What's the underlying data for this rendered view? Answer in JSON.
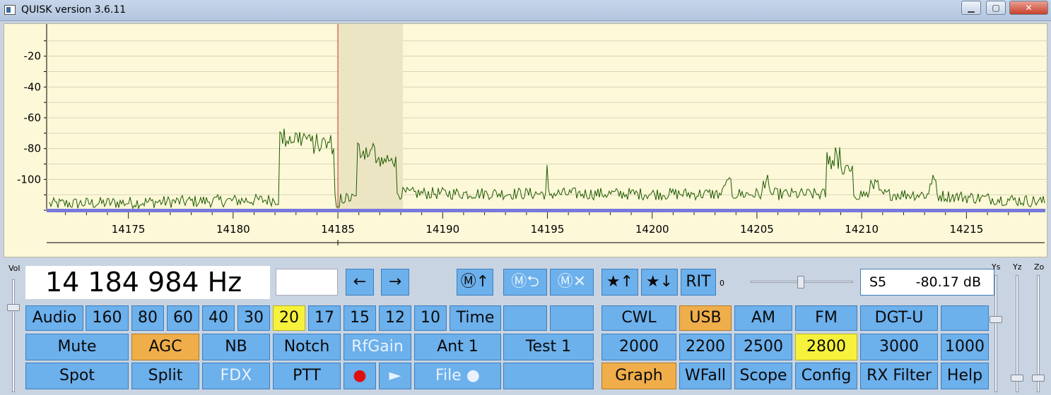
{
  "window": {
    "title": "QUISK version 3.6.11"
  },
  "graph": {
    "y_ticks": [
      "-20",
      "-40",
      "-60",
      "-80",
      "-100"
    ],
    "x_ticks": [
      "14175",
      "14180",
      "14185",
      "14190",
      "14195",
      "14200",
      "14205",
      "14210",
      "14215"
    ],
    "tuned_khz": 14185,
    "passband_khz": [
      14185,
      14188.1
    ],
    "x_range_khz": [
      14171.1,
      14218.9
    ],
    "y_range_db": [
      -120,
      0
    ],
    "colors": {
      "background": "#fcf8d8",
      "trace": "#1f5a00",
      "cursor": "#c83030",
      "baseline": "#7878dc",
      "passband": "#ece5c3"
    }
  },
  "freq": {
    "display": "14 184 984 Hz"
  },
  "nav": {
    "left": "←",
    "right": "→"
  },
  "memory": {
    "save": "Ⓜ↑",
    "swap": "Ⓜ⮌",
    "delete": "Ⓜ✕"
  },
  "favorites": {
    "up": "★↑",
    "down": "★↓"
  },
  "rit": {
    "label": "RIT",
    "value": "0"
  },
  "smeter": {
    "level": "S5",
    "db": "-80.17 dB"
  },
  "sliders": {
    "vol": "Vol",
    "ys": "Ys",
    "yz": "Yz",
    "zo": "Zo"
  },
  "row1": [
    "Audio",
    "160",
    "80",
    "60",
    "40",
    "30",
    "20",
    "17",
    "15",
    "12",
    "10",
    "Time",
    "",
    ""
  ],
  "row2": [
    "Mute",
    "AGC",
    "NB",
    "Notch",
    "RfGain",
    "Ant 1",
    "Test 1"
  ],
  "row3": [
    "Spot",
    "Split",
    "FDX",
    "PTT",
    "●",
    "►",
    "File ●",
    ""
  ],
  "modes": [
    "CWL",
    "USB",
    "AM",
    "FM",
    "DGT-U",
    ""
  ],
  "filters": [
    "2000",
    "2200",
    "2500",
    "2800",
    "3000",
    "1000"
  ],
  "bottom_right": [
    "Graph",
    "WFall",
    "Scope",
    "Config",
    "RX Filter",
    "Help"
  ],
  "state": {
    "band": "20",
    "mode": "USB",
    "filter": "2800",
    "view": "Graph",
    "agc": "AGC"
  }
}
